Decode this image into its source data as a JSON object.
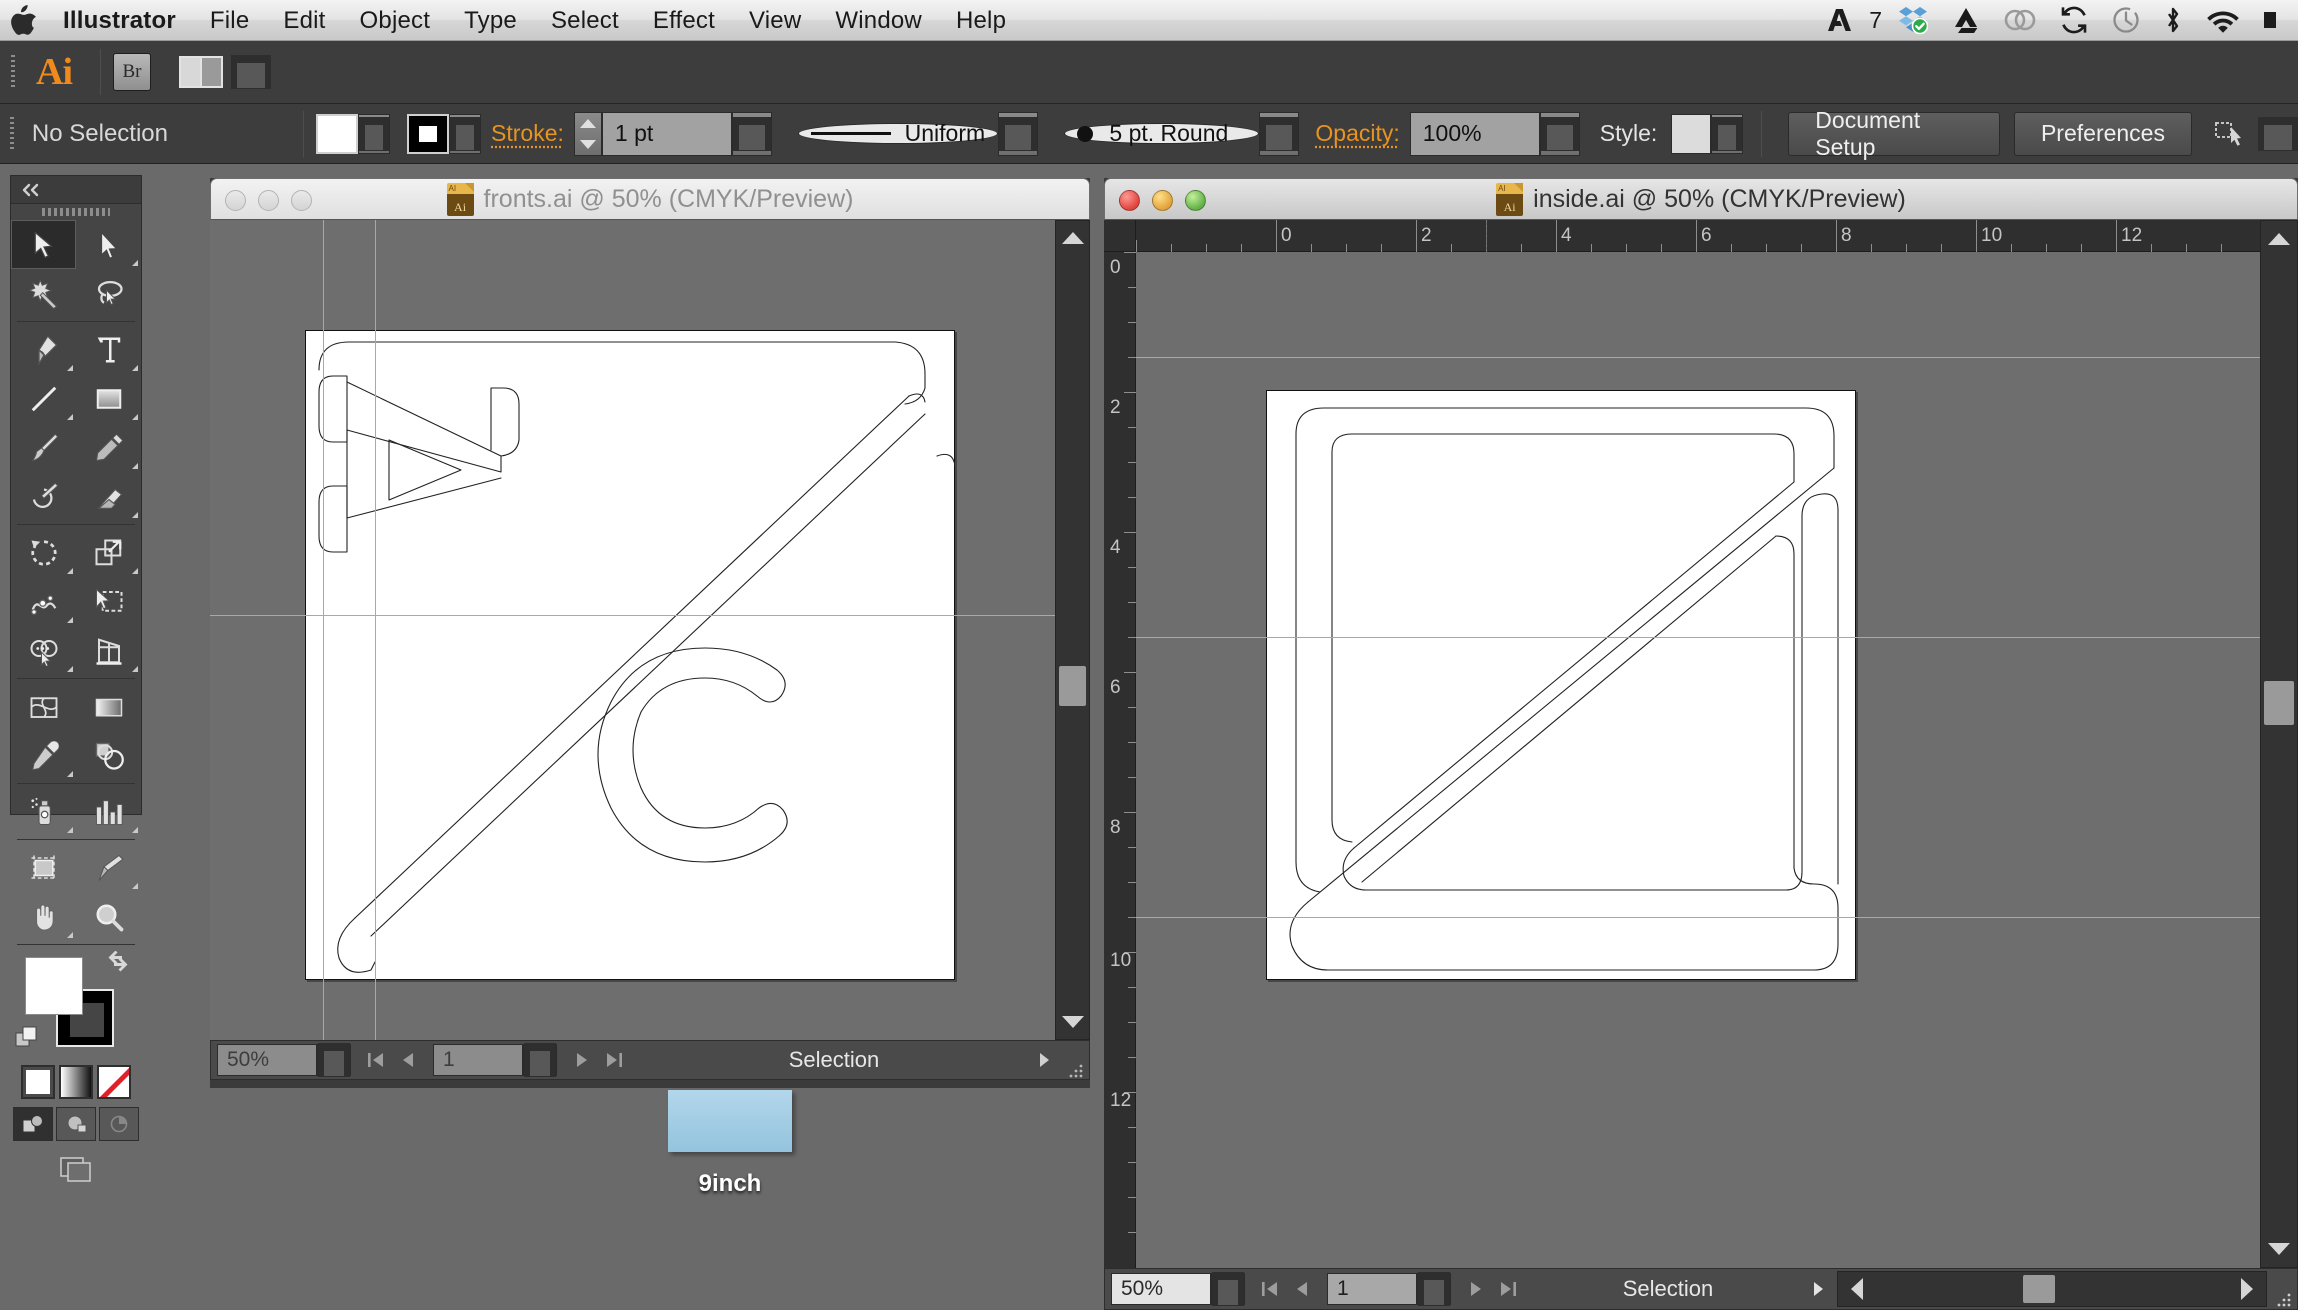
{
  "menubar": {
    "apple_icon": "apple-logo",
    "items": [
      {
        "label": "Illustrator",
        "bold": true
      },
      {
        "label": "File"
      },
      {
        "label": "Edit"
      },
      {
        "label": "Object"
      },
      {
        "label": "Type"
      },
      {
        "label": "Select"
      },
      {
        "label": "Effect"
      },
      {
        "label": "View"
      },
      {
        "label": "Window"
      },
      {
        "label": "Help"
      }
    ],
    "tray": [
      {
        "icon": "adobe-a-icon",
        "label": ""
      },
      {
        "icon": "wifi-count-text",
        "label": "7"
      },
      {
        "icon": "dropbox-icon",
        "label": ""
      },
      {
        "icon": "google-drive-icon",
        "label": ""
      },
      {
        "icon": "creative-cloud-icon",
        "label": ""
      },
      {
        "icon": "sync-refresh-icon",
        "label": ""
      },
      {
        "icon": "time-machine-icon",
        "label": ""
      },
      {
        "icon": "bluetooth-icon",
        "label": ""
      },
      {
        "icon": "wifi-icon",
        "label": ""
      },
      {
        "icon": "battery-icon",
        "label": ""
      }
    ]
  },
  "appbar": {
    "logo": "Ai",
    "bridge_label": "Br",
    "arrange_tooltip": "Arrange Documents"
  },
  "controlbar": {
    "selection_status": "No Selection",
    "fill_color": "#ffffff",
    "stroke_color": "#000000",
    "stroke_label": "Stroke:",
    "stroke_weight": "1 pt",
    "stroke_profile": "Uniform",
    "brush_definition": "5 pt. Round",
    "opacity_label": "Opacity:",
    "opacity_value": "100%",
    "style_label": "Style:",
    "document_setup_label": "Document Setup",
    "preferences_label": "Preferences"
  },
  "toolpanel": {
    "collapse_icon": "double-chevron-left-icon",
    "tools": [
      {
        "name": "selection-tool",
        "active": true,
        "sub": false
      },
      {
        "name": "direct-selection-tool",
        "active": false,
        "sub": true
      },
      {
        "name": "magic-wand-tool",
        "active": false,
        "sub": false
      },
      {
        "name": "lasso-tool",
        "active": false,
        "sub": false
      },
      {
        "name": "pen-tool",
        "active": false,
        "sub": true
      },
      {
        "name": "type-tool",
        "active": false,
        "sub": true
      },
      {
        "name": "line-segment-tool",
        "active": false,
        "sub": true
      },
      {
        "name": "rectangle-tool",
        "active": false,
        "sub": true
      },
      {
        "name": "paintbrush-tool",
        "active": false,
        "sub": false
      },
      {
        "name": "pencil-tool",
        "active": false,
        "sub": true
      },
      {
        "name": "blob-brush-tool",
        "active": false,
        "sub": false
      },
      {
        "name": "eraser-tool",
        "active": false,
        "sub": true
      },
      {
        "name": "rotate-tool",
        "active": false,
        "sub": true
      },
      {
        "name": "scale-tool",
        "active": false,
        "sub": true
      },
      {
        "name": "width-tool",
        "active": false,
        "sub": true
      },
      {
        "name": "free-transform-tool",
        "active": false,
        "sub": false
      },
      {
        "name": "shape-builder-tool",
        "active": false,
        "sub": true
      },
      {
        "name": "perspective-grid-tool",
        "active": false,
        "sub": true
      },
      {
        "name": "mesh-tool",
        "active": false,
        "sub": false
      },
      {
        "name": "gradient-tool",
        "active": false,
        "sub": false
      },
      {
        "name": "eyedropper-tool",
        "active": false,
        "sub": true
      },
      {
        "name": "blend-tool",
        "active": false,
        "sub": false
      },
      {
        "name": "symbol-sprayer-tool",
        "active": false,
        "sub": true
      },
      {
        "name": "column-graph-tool",
        "active": false,
        "sub": true
      },
      {
        "name": "artboard-tool",
        "active": false,
        "sub": false
      },
      {
        "name": "slice-tool",
        "active": false,
        "sub": true
      },
      {
        "name": "hand-tool",
        "active": false,
        "sub": true
      },
      {
        "name": "zoom-tool",
        "active": false,
        "sub": false
      }
    ],
    "fill_color": "#ffffff",
    "stroke_color": "#000000",
    "color_modes": [
      "color-swatch-white",
      "gradient-swatch",
      "none-swatch"
    ],
    "screen_modes": [
      "screen-mode-normal",
      "screen-mode-fullscreen-menubar",
      "screen-mode-fullscreen"
    ]
  },
  "windows": [
    {
      "id": "fronts",
      "title": "fronts.ai @ 50% (CMYK/Preview)",
      "active": false,
      "file_icon": "ai-document-icon",
      "statusbar": {
        "zoom": "50%",
        "page": "1",
        "status": "Selection",
        "nav_first": "first-artboard-icon",
        "nav_prev": "previous-artboard-icon",
        "nav_next": "next-artboard-icon",
        "nav_last": "last-artboard-icon"
      }
    },
    {
      "id": "inside",
      "title": "inside.ai @ 50% (CMYK/Preview)",
      "active": true,
      "file_icon": "ai-document-icon",
      "ruler": {
        "h_labels": [
          "0",
          "2",
          "4",
          "6",
          "8",
          "10",
          "12"
        ],
        "v_labels": [
          "0",
          "2",
          "4",
          "6",
          "8",
          "10",
          "12"
        ],
        "units": "inches"
      },
      "statusbar": {
        "zoom": "50%",
        "page": "1",
        "status": "Selection",
        "nav_first": "first-artboard-icon",
        "nav_prev": "previous-artboard-icon",
        "nav_next": "next-artboard-icon",
        "nav_last": "last-artboard-icon"
      }
    }
  ],
  "desktop": {
    "icon_label": "9inch",
    "thumb_color": "#a5cde3"
  },
  "colors": {
    "guide_cyan": "#22e0e8",
    "canvas_gray": "#6e6e6e",
    "panel_gray": "#3d3d3d",
    "accent_orange": "#e8941f",
    "artboard_white": "#ffffff"
  }
}
